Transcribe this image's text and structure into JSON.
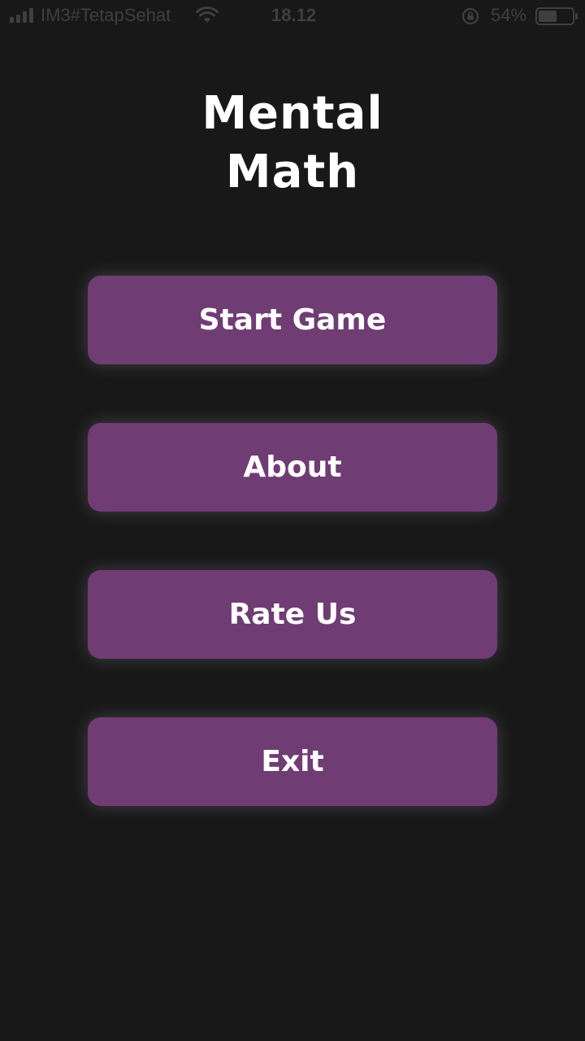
{
  "status_bar": {
    "carrier": "IM3#TetapSehat",
    "time": "18.12",
    "battery_percent": "54%",
    "battery_level": 0.54,
    "icons": [
      "signal-icon",
      "wifi-icon",
      "rotation-lock-icon",
      "battery-icon"
    ]
  },
  "app": {
    "title_line1": "Mental",
    "title_line2": "Math"
  },
  "menu": {
    "start_label": "Start Game",
    "about_label": "About",
    "rate_label": "Rate Us",
    "exit_label": "Exit"
  },
  "colors": {
    "background": "#181818",
    "button": "#6f3c74",
    "text": "#ffffff",
    "status_bar_text": "#3f3f3f"
  }
}
